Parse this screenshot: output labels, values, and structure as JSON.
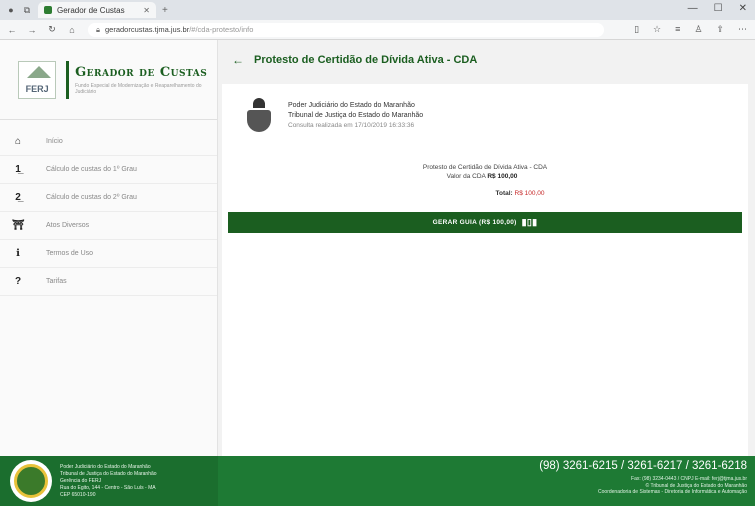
{
  "browser": {
    "tab_title": "Gerador de Custas",
    "url_host": "geradorcustas.tjma.jus.br",
    "url_path": "/#/cda-protesto/info"
  },
  "sidebar": {
    "brand_logo": "FERJ",
    "brand_title": "Gerador de Custas",
    "brand_subtitle": "Fundo Especial de Modernização e Reaparelhamento do Judiciário",
    "items": [
      {
        "icon": "home-icon",
        "glyph": "⌂",
        "label": "Início"
      },
      {
        "icon": "first-instance-icon",
        "glyph": "1̲",
        "label": "Cálculo de custas do 1º Grau"
      },
      {
        "icon": "second-instance-icon",
        "glyph": "2̲",
        "label": "Cálculo de custas do 2º Grau"
      },
      {
        "icon": "bank-icon",
        "glyph": "⛩",
        "label": "Atos Diversos"
      },
      {
        "icon": "info-icon",
        "glyph": "ℹ",
        "label": "Termos de Uso"
      },
      {
        "icon": "help-icon",
        "glyph": "?",
        "label": "Tarifas"
      }
    ]
  },
  "main": {
    "title": "Protesto de Certidão de Dívida Ativa - CDA",
    "cert": {
      "line1": "Poder Judiciário do Estado do Maranhão",
      "line2": "Tribunal de Justiça do Estado do Maranhão",
      "line3": "Consulta realizada em 17/10/2019 16:33:36"
    },
    "summary": {
      "item": "Protesto de Certidão de Dívida Ativa - CDA",
      "value_label": "Valor da CDA",
      "value": "R$ 100,00",
      "total_label": "Total:",
      "total_value": "R$ 100,00"
    },
    "button_label": "GERAR GUIA (R$ 100,00)"
  },
  "footer": {
    "left_lines": [
      "Poder Judiciário do Estado do Maranhão",
      "Tribunal de Justiça do Estado do Maranhão",
      "Gerência do FERJ",
      "Rua do Egito, 144 - Centro - São Luís - MA",
      "CEP 65010-190"
    ],
    "phones": "(98) 3261-6215 / 3261-6217 / 3261-6218",
    "contact": "Fax: (98) 3234-0443 / CNPJ E-mail: ferj@tjma.jus.br",
    "copyright": "© Tribunal de Justiça do Estado do Maranhão",
    "credits": "Coordenadoria de Sistemas - Diretoria de Informática e Automação"
  }
}
